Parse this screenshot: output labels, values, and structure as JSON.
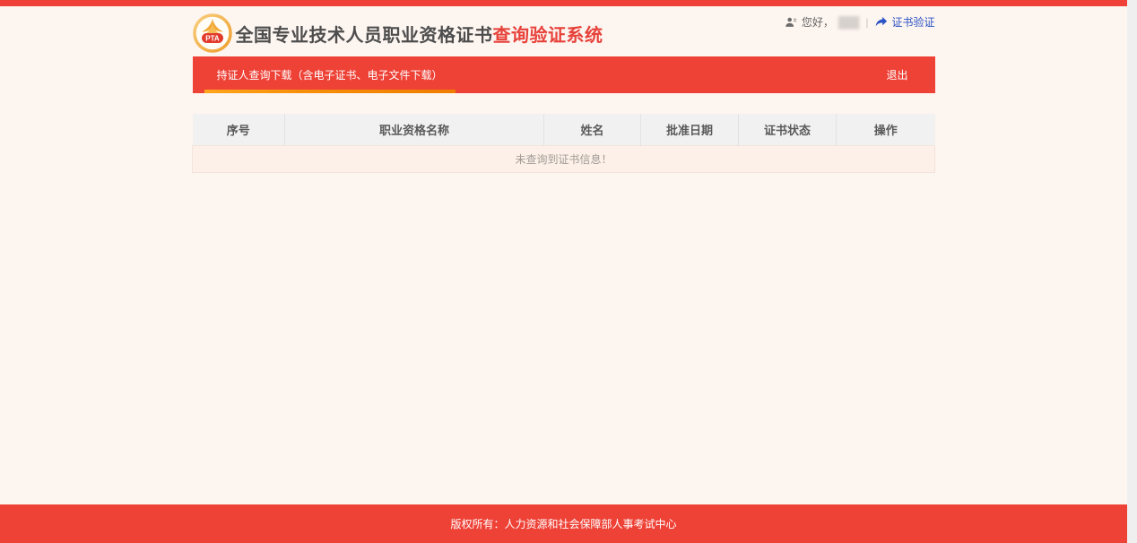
{
  "colors": {
    "accent_red": "#ee4237",
    "top_line_red": "#ef4138",
    "tab_underline_orange": "#ffa41b",
    "link_blue": "#2a52c5",
    "page_bg": "#fdf5f0",
    "empty_row_bg": "#fcf0e9",
    "table_header_bg": "#f1f1f1"
  },
  "header": {
    "logo_text": "PTA",
    "title_dark": "全国专业技术人员职业资格证书",
    "title_red": "查询验证系统",
    "user": {
      "greeting": "您好，",
      "name_masked": "███",
      "separator": "|",
      "verify_link": "证书验证"
    },
    "icons": {
      "user": "user-icon",
      "share": "share-arrow-icon"
    }
  },
  "nav": {
    "tab_label": "持证人查询下载（含电子证书、电子文件下载）",
    "logout_label": "退出"
  },
  "table": {
    "headers": [
      "序号",
      "职业资格名称",
      "姓名",
      "批准日期",
      "证书状态",
      "操作"
    ],
    "empty_message": "未查询到证书信息！"
  },
  "footer": {
    "copyright": "版权所有：人力资源和社会保障部人事考试中心"
  }
}
